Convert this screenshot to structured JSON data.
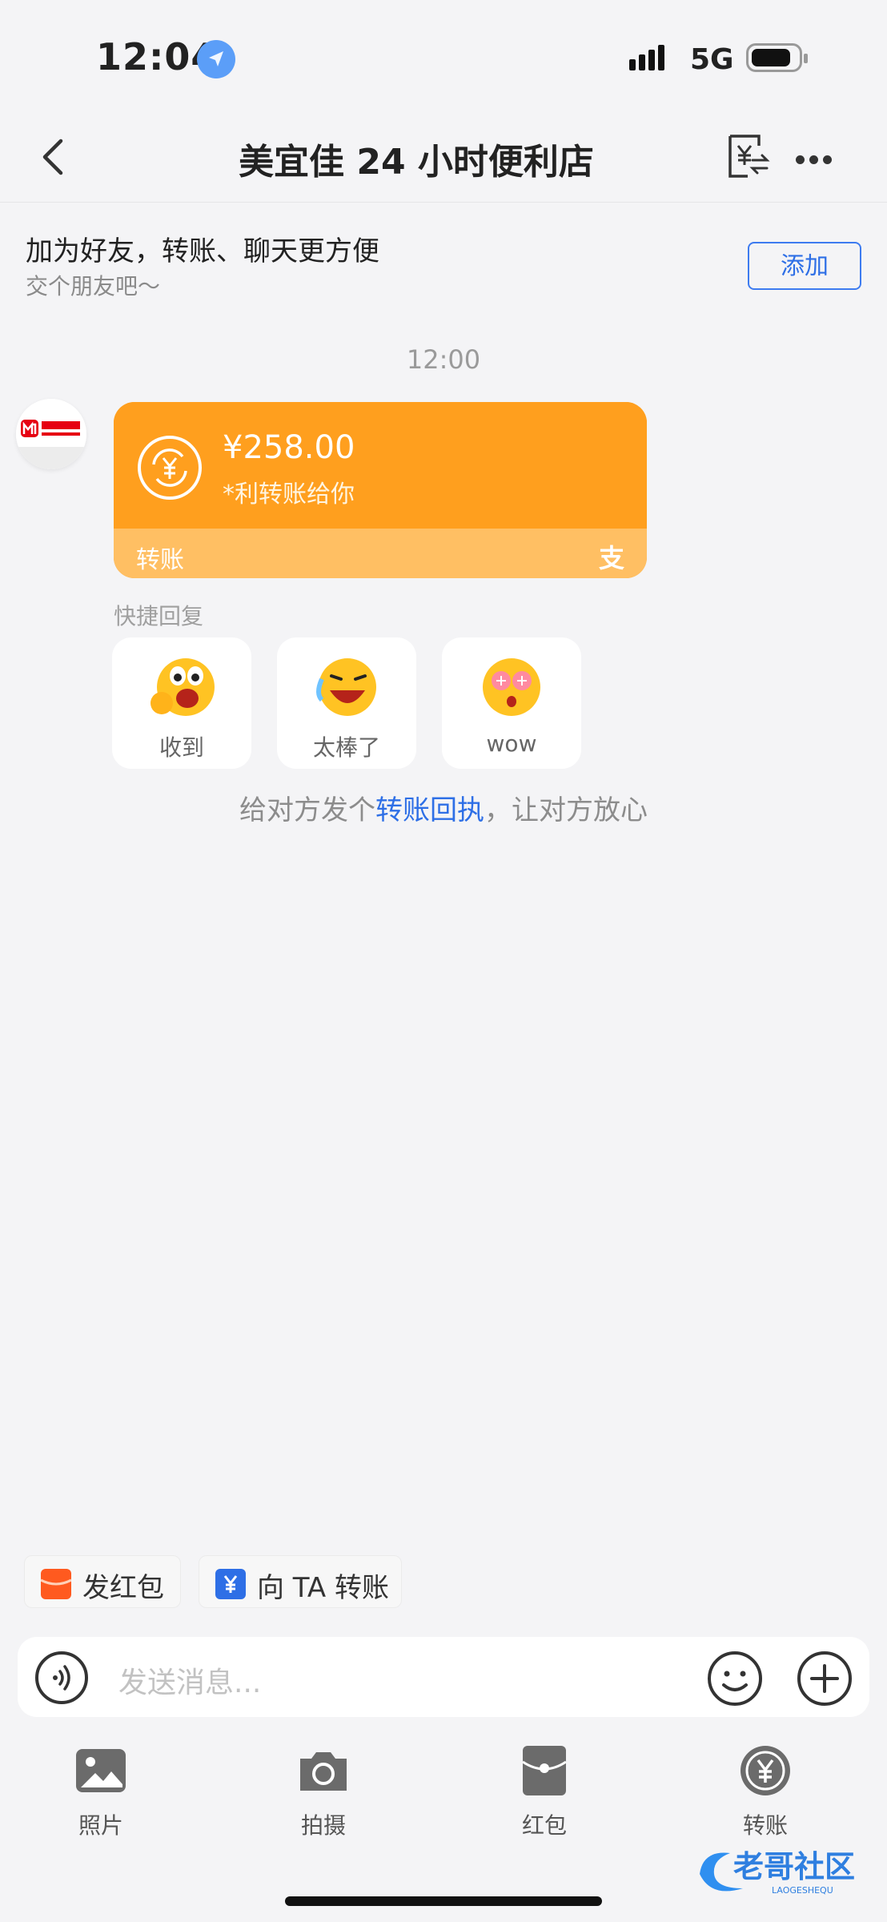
{
  "status_bar": {
    "time": "12:04",
    "network": "5G"
  },
  "nav": {
    "title": "美宜佳 24 小时便利店"
  },
  "friend_banner": {
    "title": "加为好友，转账、聊天更方便",
    "subtitle": "交个朋友吧～",
    "add_button": "添加"
  },
  "chat": {
    "timestamp": "12:00",
    "avatar_text": "美宜佳",
    "transfer_card": {
      "amount": "¥258.00",
      "note": "*利转账给你",
      "label": "转账",
      "brand": "支"
    },
    "quick_reply": {
      "label": "快捷回复",
      "items": [
        {
          "label": "收到"
        },
        {
          "label": "太棒了"
        },
        {
          "label": "wow"
        }
      ]
    },
    "receipt_prefix": "给对方发个",
    "receipt_link": "转账回执",
    "receipt_suffix": "，让对方放心"
  },
  "shortcuts": {
    "red_packet": "发红包",
    "transfer_to": "向 TA 转账"
  },
  "input": {
    "placeholder": "发送消息..."
  },
  "toolbar": [
    {
      "label": "照片"
    },
    {
      "label": "拍摄"
    },
    {
      "label": "红包"
    },
    {
      "label": "转账"
    }
  ],
  "watermark": {
    "text": "老哥社区",
    "sub": "LAOGESHEQU"
  },
  "colors": {
    "accent_blue": "#2e6fe6",
    "transfer_orange": "#ff9f1e",
    "transfer_light": "#ffbf63"
  }
}
